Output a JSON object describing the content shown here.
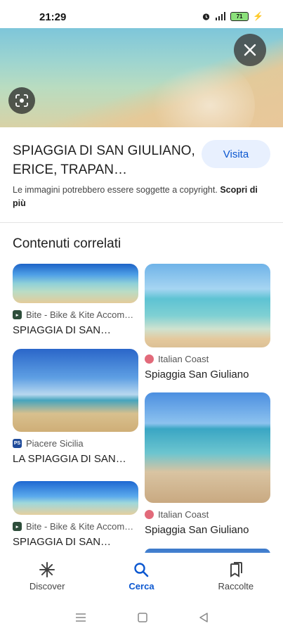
{
  "status_bar": {
    "time": "21:29",
    "battery": "71"
  },
  "hero": {
    "lens_icon": "lens-icon",
    "close_icon": "close-icon"
  },
  "result": {
    "title": "SPIAGGIA DI SAN GIULIANO, ERICE, TRAPAN…",
    "visit_label": "Visita",
    "copyright_text": "Le immagini potrebbero essere soggette a copyright.",
    "learn_more": "Scopri di più"
  },
  "related": {
    "heading": "Contenuti correlati",
    "left_column": [
      {
        "source": "Bite - Bike & Kite Accom…",
        "favicon": "bite-favicon",
        "title": "SPIAGGIA DI SAN…"
      },
      {
        "source": "Piacere Sicilia",
        "favicon": "ps-favicon",
        "favicon_text": "PS",
        "title": "LA SPIAGGIA DI SAN…"
      },
      {
        "source": "Bite - Bike & Kite Accom…",
        "favicon": "bite-favicon",
        "title": "SPIAGGIA DI SAN…"
      }
    ],
    "right_column": [
      {
        "source": "Italian Coast",
        "favicon": "italian-coast-favicon",
        "title": "Spiaggia San Giuliano"
      },
      {
        "source": "Italian Coast",
        "favicon": "italian-coast-favicon",
        "title": "Spiaggia San Giuliano"
      }
    ]
  },
  "bottom_nav": [
    {
      "label": "Discover",
      "icon": "asterisk-icon",
      "active": false
    },
    {
      "label": "Cerca",
      "icon": "search-icon",
      "active": true
    },
    {
      "label": "Raccolte",
      "icon": "collections-icon",
      "active": false
    }
  ],
  "colors": {
    "accent": "#0b57d0",
    "visit_bg": "#e8f0fe"
  }
}
